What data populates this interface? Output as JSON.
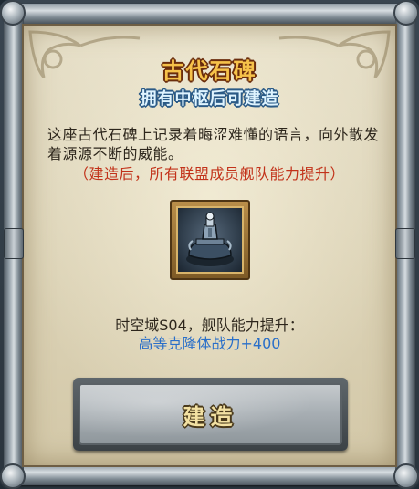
{
  "dialog": {
    "title": "古代石碑",
    "subtitle": "拥有中枢后可建造",
    "description": "这座古代石碑上记录着晦涩难懂的语言，向外散发着源源不断的威能。",
    "note": "（建造后，所有联盟成员舰队能力提升）"
  },
  "item": {
    "icon": "stone-monument-icon"
  },
  "bonus": {
    "label": "时空域S04，舰队能力提升：",
    "value": "高等克隆体战力+400"
  },
  "actions": {
    "build_label": "建造"
  },
  "colors": {
    "title": "#f6c24a",
    "subtitle": "#dff4ff",
    "note": "#c2321a",
    "bonus_value": "#2a6fc9",
    "parchment": "#ddd4b8"
  }
}
